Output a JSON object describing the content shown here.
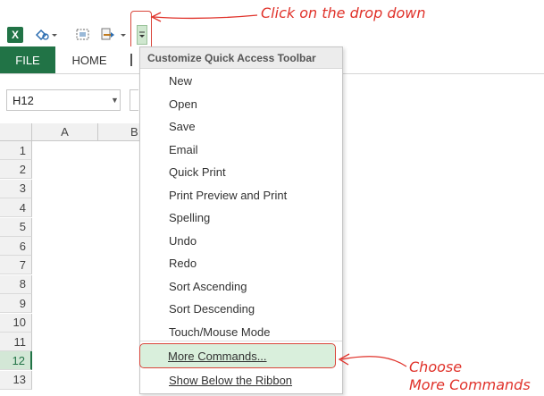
{
  "toolbar": {
    "excel_logo": "X",
    "icons": [
      "excel-logo-icon",
      "touch-mode-icon",
      "page-layout-icon",
      "format-painter-icon",
      "customize-dropdown-icon"
    ]
  },
  "ribbon": {
    "tabs": [
      {
        "label": "FILE",
        "active": true
      },
      {
        "label": "HOME",
        "active": false
      }
    ]
  },
  "namebox": {
    "value": "H12"
  },
  "grid": {
    "columns": [
      "A",
      "B"
    ],
    "rows": [
      "1",
      "2",
      "3",
      "4",
      "5",
      "6",
      "7",
      "8",
      "9",
      "10",
      "11",
      "12",
      "13"
    ],
    "active_row": "12"
  },
  "menu": {
    "header": "Customize Quick Access Toolbar",
    "items": [
      {
        "label": "New"
      },
      {
        "label": "Open"
      },
      {
        "label": "Save"
      },
      {
        "label": "Email"
      },
      {
        "label": "Quick Print"
      },
      {
        "label": "Print Preview and Print"
      },
      {
        "label": "Spelling"
      },
      {
        "label": "Undo"
      },
      {
        "label": "Redo"
      },
      {
        "label": "Sort Ascending"
      },
      {
        "label": "Sort Descending"
      },
      {
        "label": "Touch/Mouse Mode"
      },
      {
        "label": "More Commands..."
      },
      {
        "label": "Show Below the Ribbon"
      }
    ]
  },
  "annotations": {
    "top": "Click on the drop down",
    "bottom_line1": "Choose",
    "bottom_line2": "More Commands"
  },
  "colors": {
    "excel_green": "#217346",
    "annotation_red": "#e0322a",
    "highlight_green": "#d9efdc"
  }
}
